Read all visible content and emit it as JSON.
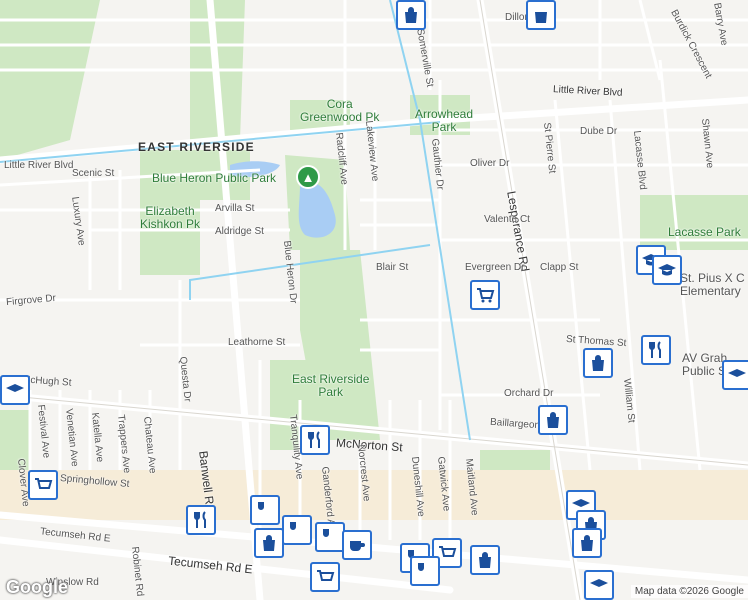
{
  "map": {
    "area_label": "EAST RIVERSIDE",
    "attribution": "Map data ©2026 Google",
    "logo": "Google",
    "parks": [
      {
        "name": "Cora Greenwood Pk",
        "lines": [
          "Cora",
          "Greenwood Pk"
        ]
      },
      {
        "name": "Arrowhead Park",
        "lines": [
          "Arrowhead",
          "Park"
        ]
      },
      {
        "name": "Blue Heron Public Park",
        "lines": [
          "Blue Heron Public Park"
        ]
      },
      {
        "name": "Elizabeth Kishkon Pk",
        "lines": [
          "Elizabeth",
          "Kishkon Pk"
        ]
      },
      {
        "name": "East Riverside Park",
        "lines": [
          "East Riverside",
          "Park"
        ]
      },
      {
        "name": "Lacasse Park",
        "lines": [
          "Lacasse Park"
        ]
      },
      {
        "name": "St. Pius X Elementary",
        "lines": [
          "St. Pius X C",
          "Elementary"
        ]
      },
      {
        "name": "AV Graham Public School",
        "lines": [
          "AV Grah",
          "Public Sc"
        ]
      }
    ],
    "major_roads": [
      "McNorton St",
      "Banwell Rd",
      "Lesperance Rd",
      "Tecumseh Rd E",
      "Little River Blvd"
    ],
    "streets": [
      "Dillon Dr",
      "Somerville St",
      "Little River Blvd",
      "Scenic St",
      "Luxury Ave",
      "Arvilla St",
      "Aldridge St",
      "Radcliff Ave",
      "Lakeview Ave",
      "Gauthier Dr",
      "Oliver Dr",
      "Valente Ct",
      "Dube Dr",
      "St Pierre St",
      "Lacasse Blvd",
      "Shawn Ave",
      "Burdick Crescent",
      "Barry Ave",
      "Firgrove Dr",
      "Blue Heron Dr",
      "Blair St",
      "Evergreen Dr",
      "Clapp St",
      "Leathorne St",
      "St Thomas St",
      "McHugh St",
      "Questa Dr",
      "Festival Ave",
      "Venetian Ave",
      "Katella Ave",
      "Trappers Ave",
      "Chateau Ave",
      "Tranquility Ave",
      "Norcrest Ave",
      "Duneshill Ave",
      "Gatwick Ave",
      "Maitland Ave",
      "Orchard Dr",
      "Baillargeon Dr",
      "William St",
      "Springhollow St",
      "Tecumseh Rd E",
      "Robinet Rd",
      "Winslow Rd",
      "Clover Ave",
      "Ganderford Ave"
    ],
    "pois": [
      {
        "type": "grocery-icon"
      },
      {
        "type": "shopping-bag-icon"
      },
      {
        "type": "restaurant-icon"
      },
      {
        "type": "school-icon"
      },
      {
        "type": "cafe-icon"
      },
      {
        "type": "park-pin-icon"
      }
    ]
  }
}
